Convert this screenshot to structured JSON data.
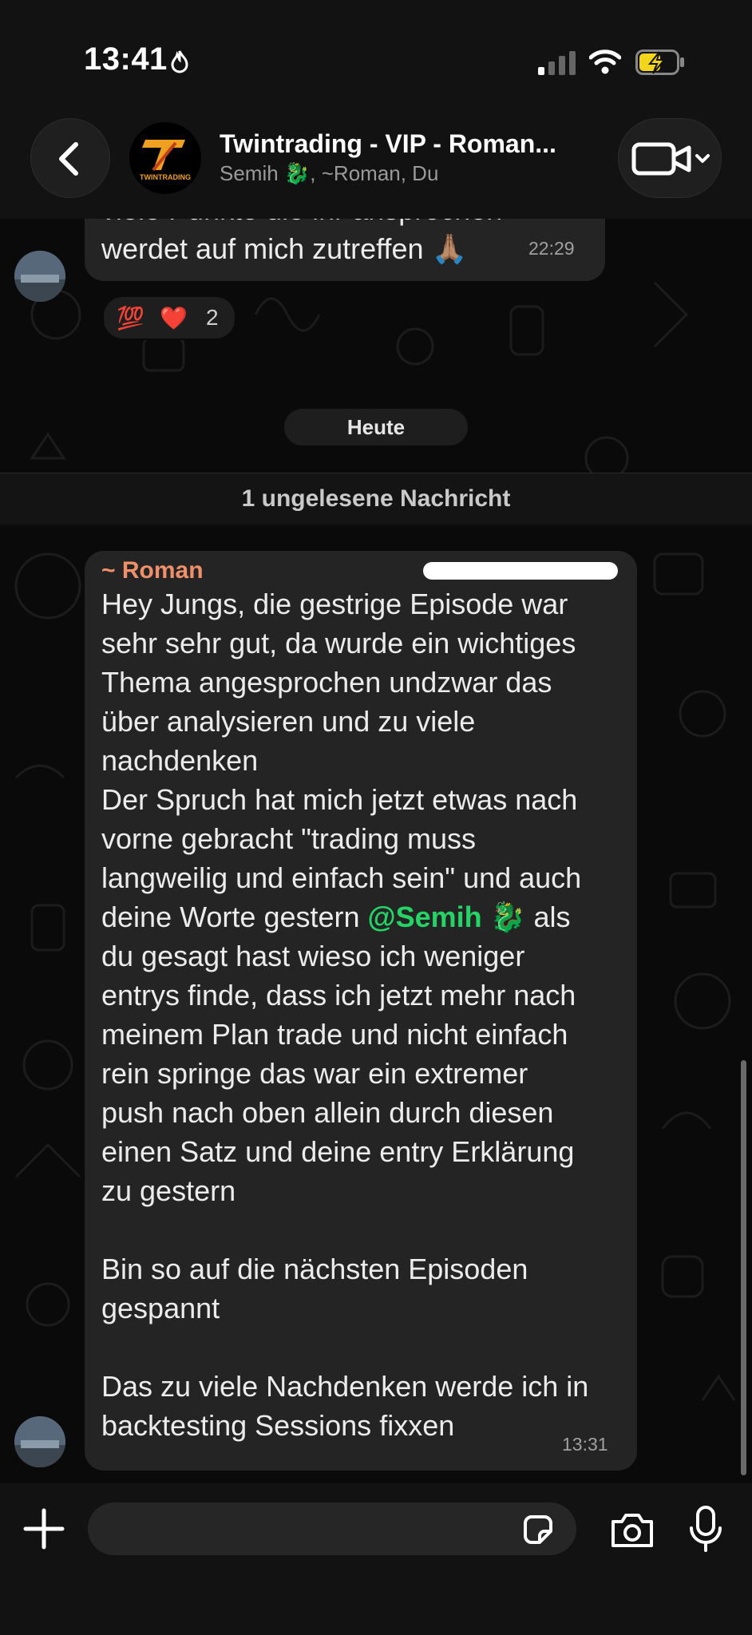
{
  "status_bar": {
    "time": "13:41"
  },
  "header": {
    "group_name": "Twintrading - VIP - Roman...",
    "members": "Semih 🐉, ~Roman, Du",
    "avatar_text": "TWINTRADING"
  },
  "prev_message": {
    "text": "viele Punkte die ihr ansprechen\nwerdet auf mich zutreffen 🙏🏽",
    "time": "22:29",
    "reactions": {
      "emoji_1": "💯",
      "emoji_2": "❤️",
      "count": "2"
    }
  },
  "date_separator": "Heute",
  "unread_banner": "1 ungelesene Nachricht",
  "message": {
    "sender": "~ Roman",
    "body_part1": "Hey Jungs, die gestrige Episode war\nsehr sehr gut, da wurde ein wichtiges\nThema angesprochen undzwar das\nüber analysieren und zu viele\nnachdenken\nDer Spruch hat mich jetzt etwas nach\nvorne gebracht \"trading muss\nlangweilig und einfach sein\" und auch\ndeine Worte gestern ",
    "mention": "@Semih 🐉",
    "body_part2": " als\ndu gesagt hast wieso ich weniger\nentrys finde, dass ich jetzt mehr nach\nmeinem Plan trade und nicht einfach\nrein springe das war ein extremer\npush nach oben allein durch diesen\neinen Satz und deine entry Erklärung\nzu gestern\n\nBin so auf die nächsten Episoden\ngespannt\n\nDas zu viele Nachdenken werde ich in\nbacktesting Sessions fixxen",
    "time": "13:31"
  },
  "composer": {
    "placeholder": ""
  },
  "colors": {
    "sender": "#f0906a",
    "mention": "#25d366",
    "bubble": "#242424",
    "background": "#0a0a0a"
  }
}
